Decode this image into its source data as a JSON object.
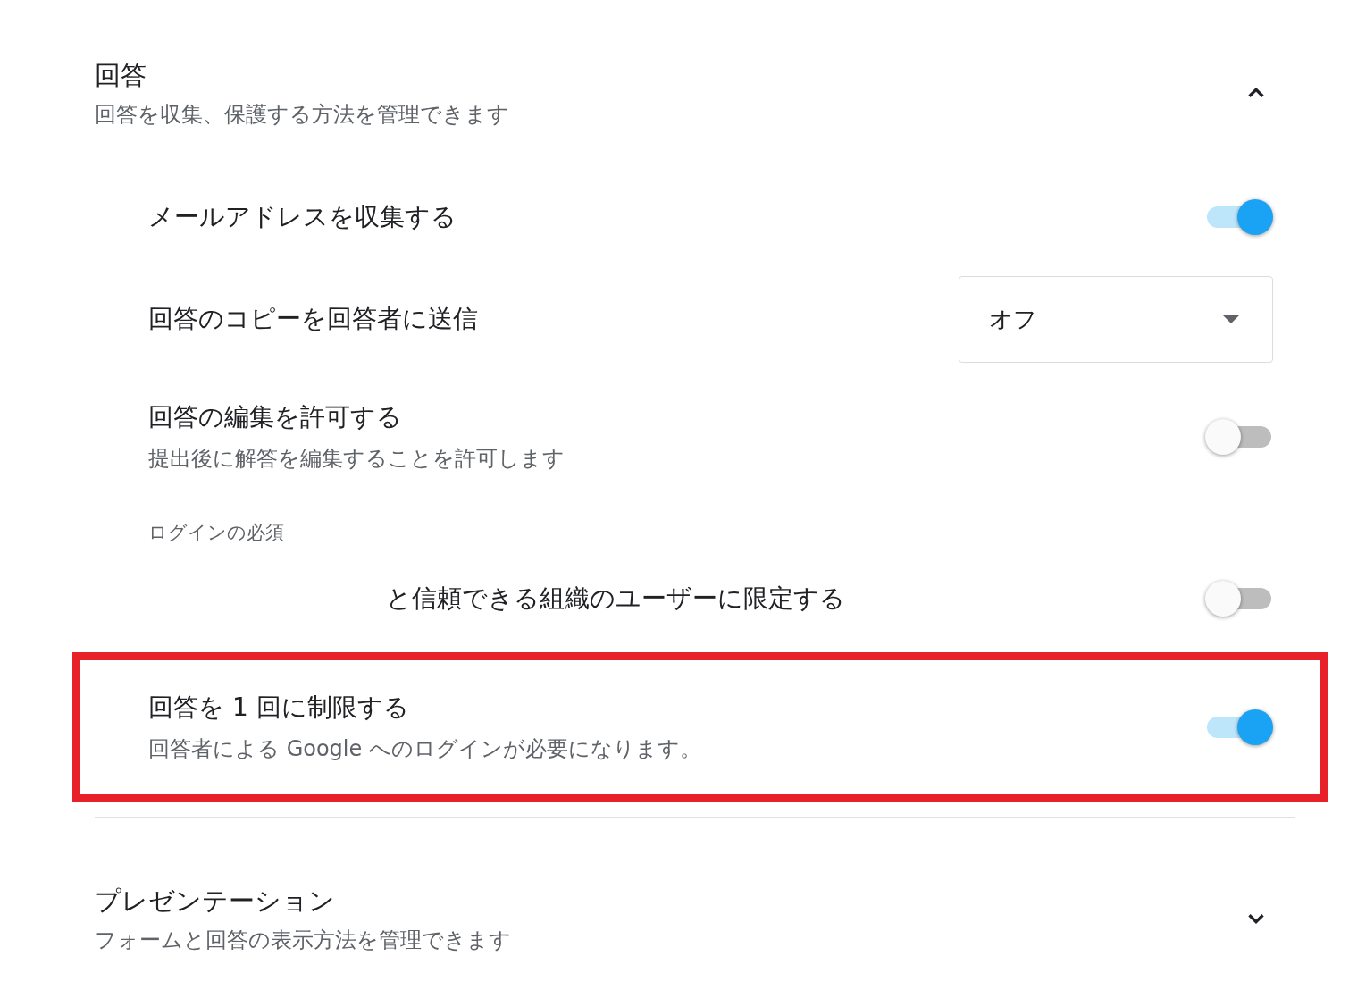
{
  "sections": [
    {
      "title": "回答",
      "subtitle": "回答を収集、保護する方法を管理できます",
      "expanded": true,
      "rows": [
        {
          "kind": "toggle",
          "label": "メールアドレスを収集する",
          "on": true,
          "highlighted": false
        },
        {
          "kind": "dropdown",
          "label": "回答のコピーを回答者に送信",
          "value": "オフ"
        },
        {
          "kind": "toggle",
          "label": "回答の編集を許可する",
          "description": "提出後に解答を編集することを許可します",
          "on": false,
          "highlighted": false
        },
        {
          "kind": "subheading",
          "label": "ログインの必須"
        },
        {
          "kind": "toggle-indented",
          "label": "と信頼できる組織のユーザーに限定する",
          "on": false,
          "highlighted": false
        },
        {
          "kind": "toggle",
          "label": "回答を 1 回に制限する",
          "description": "回答者による Google へのログインが必要になります。",
          "on": true,
          "highlighted": true
        }
      ]
    },
    {
      "title": "プレゼンテーション",
      "subtitle": "フォームと回答の表示方法を管理できます",
      "expanded": false
    }
  ]
}
